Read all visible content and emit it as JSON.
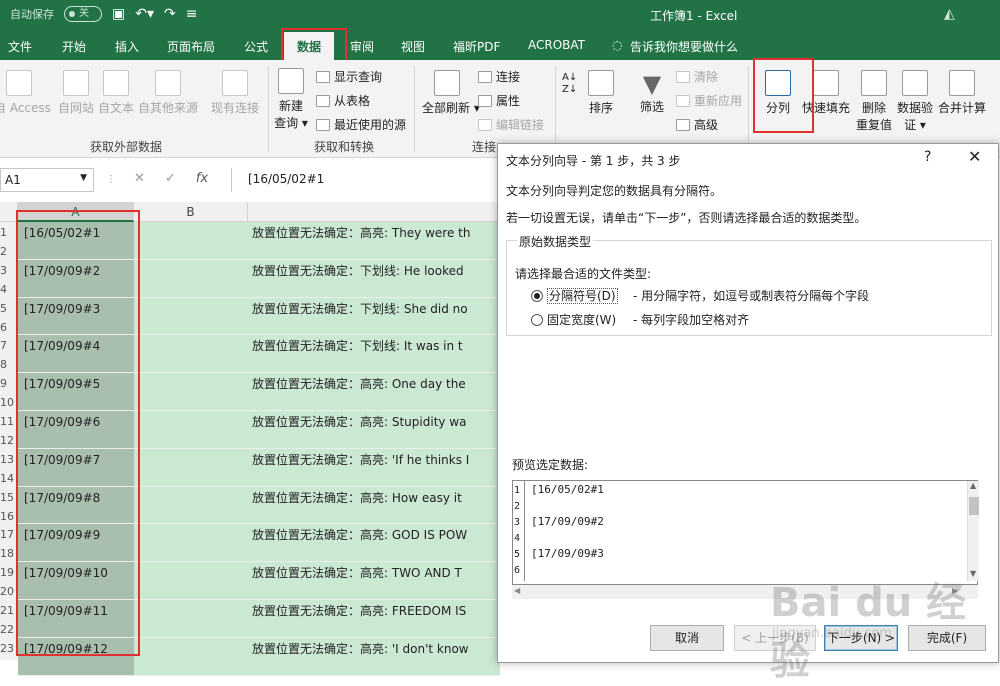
{
  "title_bar": {
    "autosave_label": "自动保存",
    "autosave_state": "关",
    "window_title": "工作簿1  -  Excel"
  },
  "ribbon_tabs": [
    "文件",
    "开始",
    "插入",
    "页面布局",
    "公式",
    "数据",
    "审阅",
    "视图",
    "福昕PDF",
    "ACROBAT",
    "告诉我你想要做什么"
  ],
  "ribbon": {
    "get_external": {
      "access": "自 Access",
      "web": "自网站",
      "text": "自文本",
      "other": "自其他来源",
      "existing": "现有连接",
      "group": "获取外部数据"
    },
    "get_transform": {
      "new_query_1": "新建",
      "new_query_2": "查询",
      "show_queries": "显示查询",
      "from_table": "从表格",
      "recent_sources": "最近使用的源",
      "group": "获取和转换"
    },
    "connections": {
      "refresh_all": "全部刷新",
      "connections": "连接",
      "properties": "属性",
      "edit_links": "编辑链接",
      "group": "连接"
    },
    "sort_filter": {
      "sort": "排序",
      "filter": "筛选",
      "clear": "清除",
      "reapply": "重新应用",
      "advanced": "高级"
    },
    "data_tools": {
      "text_to_columns": "分列",
      "flash_fill": "快速填充",
      "remove_dup_1": "删除",
      "remove_dup_2": "重复值",
      "validation_1": "数据验",
      "validation_2": "证",
      "consolidate": "合并计算"
    }
  },
  "formula_bar": {
    "name_box": "A1",
    "fx": "fx",
    "value": "[16/05/02#1"
  },
  "sheet": {
    "columns": [
      "A",
      "B"
    ],
    "rows": [
      {
        "num": "1",
        "a": "[16/05/02#1",
        "c": "放置位置无法确定：高亮: They were th"
      },
      {
        "num": "3",
        "a": "[17/09/09#2",
        "c": "放置位置无法确定：下划线: He looked"
      },
      {
        "num": "5",
        "a": "[17/09/09#3",
        "c": "放置位置无法确定：下划线: She did no"
      },
      {
        "num": "7",
        "a": "[17/09/09#4",
        "c": "放置位置无法确定：下划线: It was in t"
      },
      {
        "num": "9",
        "a": "[17/09/09#5",
        "c": "放置位置无法确定：高亮: One day the"
      },
      {
        "num": "11",
        "a": "[17/09/09#6",
        "c": "放置位置无法确定：高亮: Stupidity wa"
      },
      {
        "num": "13",
        "a": "[17/09/09#7",
        "c": "放置位置无法确定：高亮: 'If he thinks I"
      },
      {
        "num": "15",
        "a": "[17/09/09#8",
        "c": "放置位置无法确定：高亮: How easy it"
      },
      {
        "num": "17",
        "a": "[17/09/09#9",
        "c": "放置位置无法确定：高亮: GOD IS POW"
      },
      {
        "num": "19",
        "a": "[17/09/09#10",
        "c": "放置位置无法确定：高亮: TWO AND T"
      },
      {
        "num": "21",
        "a": "[17/09/09#11",
        "c": "放置位置无法确定：高亮: FREEDOM IS"
      },
      {
        "num": "23",
        "a": "[17/09/09#12",
        "c": "放置位置无法确定：高亮: 'I don't know"
      }
    ],
    "inter_rows": [
      "2",
      "4",
      "6",
      "8",
      "10",
      "12",
      "14",
      "16",
      "18",
      "20",
      "22"
    ]
  },
  "dialog": {
    "title": "文本分列向导 - 第 1 步，共 3 步",
    "help": "?",
    "close": "✕",
    "line1": "文本分列向导判定您的数据具有分隔符。",
    "line2": "若一切设置无误，请单击“下一步”，否则请选择最合适的数据类型。",
    "group_label": "原始数据类型",
    "choose_label": "请选择最合适的文件类型:",
    "opt1_label": "分隔符号(D)",
    "opt1_desc": "- 用分隔字符，如逗号或制表符分隔每个字段",
    "opt2_label": "固定宽度(W)",
    "opt2_desc": "- 每列字段加空格对齐",
    "preview_label": "预览选定数据:",
    "preview_nums": [
      "1",
      "2",
      "3",
      "4",
      "5",
      "6"
    ],
    "preview_vals": [
      "[16/05/02#1",
      "",
      "[17/09/09#2",
      "",
      "[17/09/09#3",
      ""
    ],
    "btn_cancel": "取消",
    "btn_back": "< 上一步(B)",
    "btn_next": "下一步(N) >",
    "btn_finish": "完成(F)"
  },
  "watermark": {
    "main": "Bai du 经验",
    "sub": "jingyan.baidu.com"
  }
}
